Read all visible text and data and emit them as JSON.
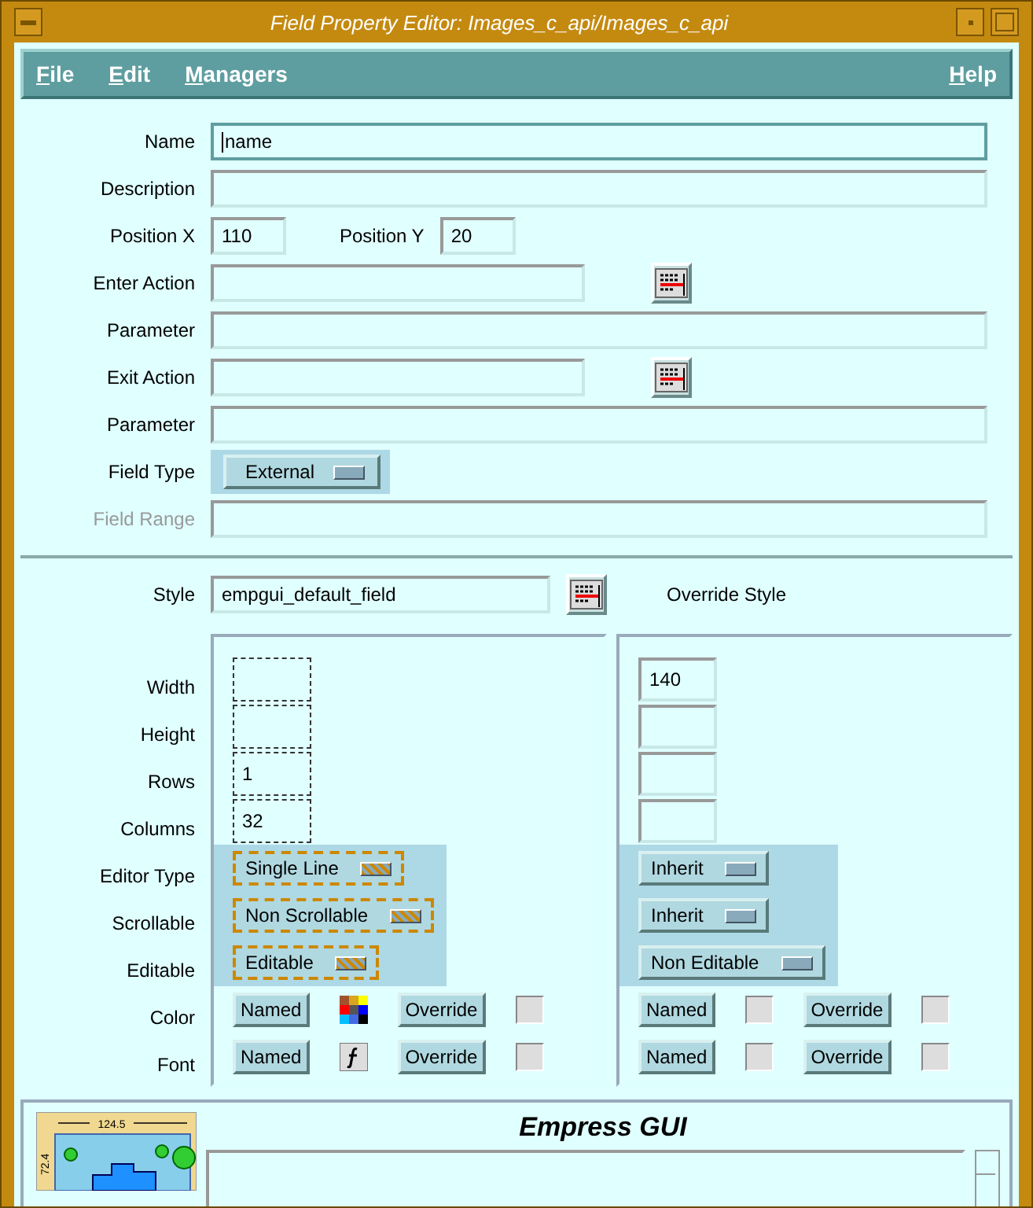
{
  "window": {
    "title": "Field Property Editor: Images_c_api/Images_c_api"
  },
  "menu": {
    "left": [
      "File",
      "Edit",
      "Managers"
    ],
    "right": [
      "Help"
    ]
  },
  "fields": [
    {
      "kind": "text",
      "label": "Name",
      "value": "name",
      "focused": true,
      "disabled": false
    },
    {
      "kind": "text",
      "label": "Description",
      "focused": false,
      "disabled": false
    },
    {
      "kind": "pair",
      "label": "Position X",
      "value": "110",
      "label2": "Position Y",
      "value2": "20"
    },
    {
      "kind": "action",
      "label": "Enter Action"
    },
    {
      "kind": "text",
      "label": "Parameter",
      "focused": false,
      "disabled": false
    },
    {
      "kind": "action",
      "label": "Exit Action"
    },
    {
      "kind": "text",
      "label": "Parameter",
      "focused": false,
      "disabled": false
    },
    {
      "kind": "dropdown",
      "label": "Field Type",
      "value": "External"
    },
    {
      "kind": "text",
      "label": "Field Range",
      "focused": false,
      "disabled": true
    }
  ],
  "style": {
    "label": "Style",
    "value": "empgui_default_field",
    "override_label": "Override Style"
  },
  "row_labels": [
    "Width",
    "Height",
    "Rows",
    "Columns",
    "Editor Type",
    "Scrollable",
    "Editable",
    "Color",
    "Font"
  ],
  "panels": [
    {
      "hatched": true,
      "inputs": [
        {
          "dotted": true
        },
        {
          "dotted": true
        },
        {
          "dotted": true,
          "value": "1"
        },
        {
          "dotted": true,
          "value": "32"
        }
      ],
      "dropdowns": [
        "Single Line",
        "Non Scrollable",
        "Editable"
      ],
      "rows": [
        {
          "kind": "color",
          "named": "Named",
          "override": "Override",
          "checked": false
        },
        {
          "kind": "font",
          "named": "Named",
          "override": "Override",
          "checked": false
        }
      ]
    },
    {
      "hatched": false,
      "inputs": [
        {
          "dotted": false,
          "value": "140"
        },
        {
          "dotted": false
        },
        {
          "dotted": false
        },
        {
          "dotted": false
        }
      ],
      "dropdowns": [
        "Inherit",
        "Inherit",
        "Non Editable"
      ],
      "rows": [
        {
          "kind": "pair",
          "named": "Named",
          "override": "Override",
          "checked": false
        },
        {
          "kind": "pair",
          "named": "Named",
          "override": "Override",
          "checked": false
        }
      ]
    }
  ],
  "banner": {
    "title": "Empress GUI",
    "logo_labels": [
      "124.5",
      "72.4"
    ]
  }
}
